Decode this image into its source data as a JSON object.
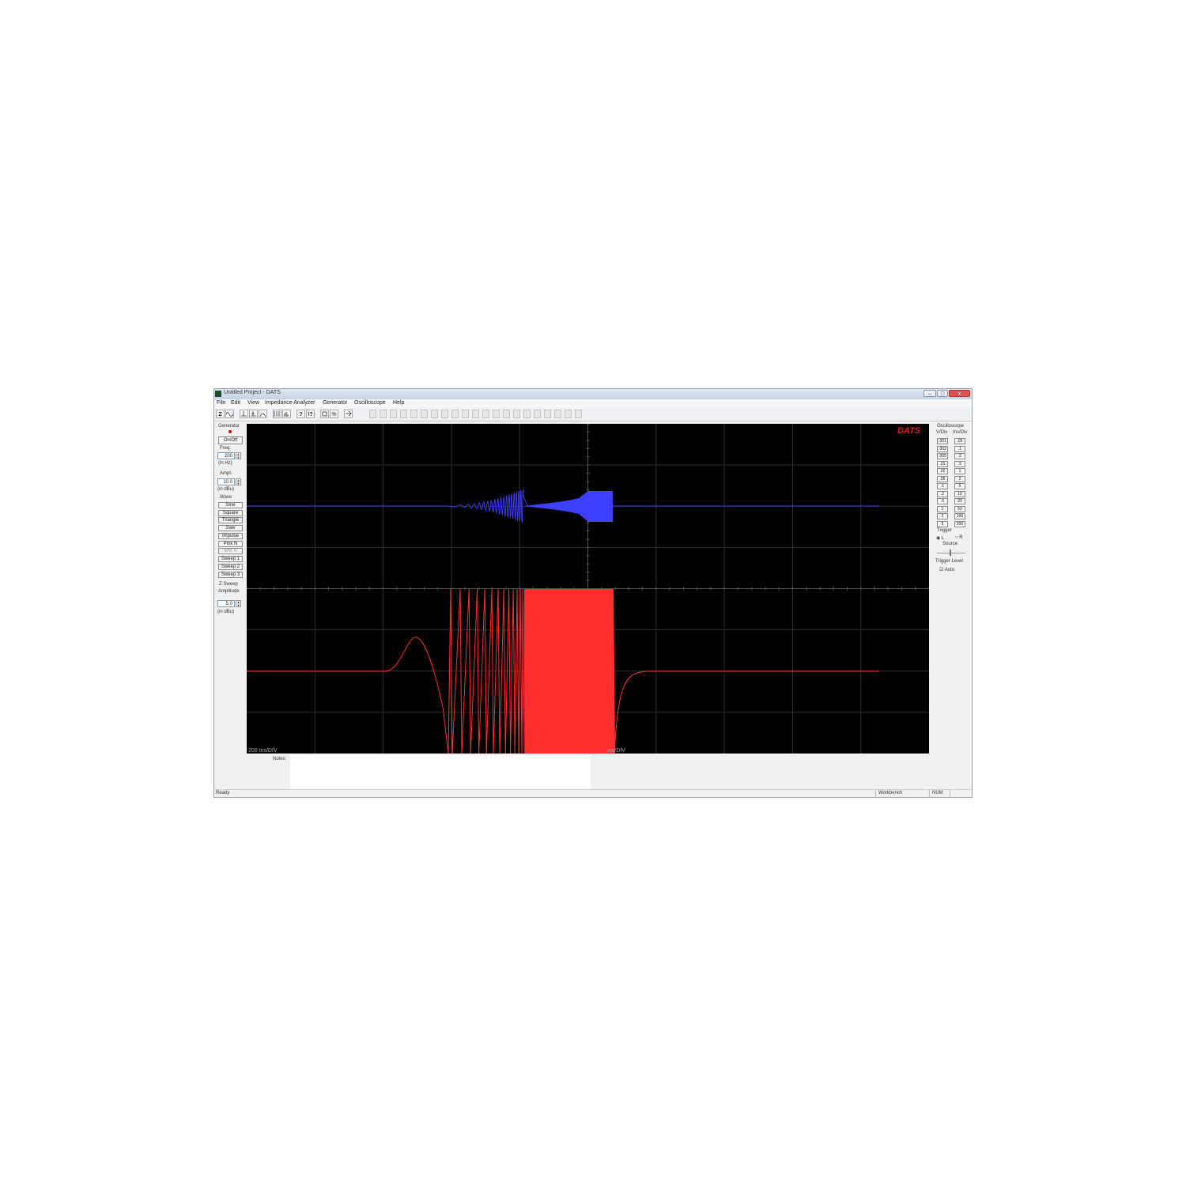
{
  "window": {
    "title": "Untitled Project - DATS",
    "minimize_label": "–",
    "maximize_label": "□",
    "close_label": "x"
  },
  "menu": [
    "File",
    "Edit",
    "View",
    "Impedance Analyzer",
    "Generator",
    "Oscilloscope",
    "Help"
  ],
  "toolbar": {
    "z_label": "Z",
    "help_label": "?",
    "whatsthis_label": "\\?",
    "percent_label": "%"
  },
  "generator": {
    "title": "Generator",
    "onoff_label": "On/Off",
    "freq_label": "Freq.",
    "freq_value": "200",
    "freq_unit": "(in Hz)",
    "ampl_label": "Ampl.",
    "ampl_value": "10.0",
    "ampl_unit": "(in dBu)",
    "wave_label": "Wave",
    "waves": [
      "Sine",
      "Square",
      "Triangle",
      "Saw",
      "Impulse",
      "Pink N",
      "Wht N",
      "Sweep 1",
      "Sweep 2",
      "Sweep 3"
    ],
    "zsweep_label": "Z Sweep",
    "amplitude_label": "Amplitude",
    "zsweep_value": "5.0",
    "zsweep_unit": "(in dBu)"
  },
  "oscilloscope": {
    "title": "Oscilloscope",
    "vdiv_label": "V/Div",
    "msdiv_label": "ms/Div",
    "vdiv_options": [
      ".001",
      ".002",
      ".005",
      ".01",
      ".02",
      ".05",
      ".1",
      ".2",
      ".5",
      "1",
      "2",
      "5"
    ],
    "msdiv_options": [
      ".05",
      ".1",
      ".2",
      ".5",
      "1",
      "2",
      "5",
      "10",
      "20",
      "50",
      "100",
      "200"
    ],
    "trigger_label": "Trigger",
    "trigger_l": "L",
    "trigger_r": "R",
    "source_label": "Source",
    "trigger_level_label": "Trigger Level",
    "auto_label": "Auto",
    "logo": "DATS",
    "left_scale": "200  ms/DIV",
    "right_scale": "ms/DIV",
    "colors": {
      "background": "#000000",
      "grid": "#2e2e2e",
      "left_channel": "#3f3fff",
      "right_channel": "#ff2f2f"
    }
  },
  "notes": {
    "label": "Notes:"
  },
  "status": {
    "ready": "Ready",
    "workbench": "Workbench",
    "num": "NUM"
  }
}
